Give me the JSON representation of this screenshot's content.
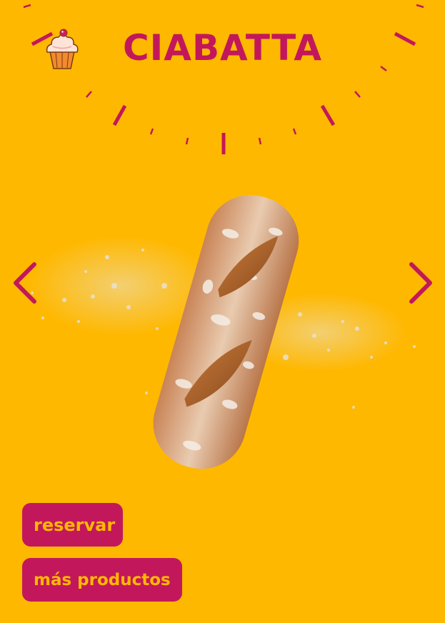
{
  "header": {
    "title": "CIABATTA",
    "logo_icon": "cupcake-icon"
  },
  "product": {
    "image_icon": "ciabatta-bread-image"
  },
  "carousel": {
    "prev_icon": "chevron-left-icon",
    "next_icon": "chevron-right-icon"
  },
  "actions": {
    "reserve_label": "reservar",
    "more_products_label": "más productos"
  },
  "colors": {
    "background": "#FFB800",
    "accent": "#C2185B"
  }
}
